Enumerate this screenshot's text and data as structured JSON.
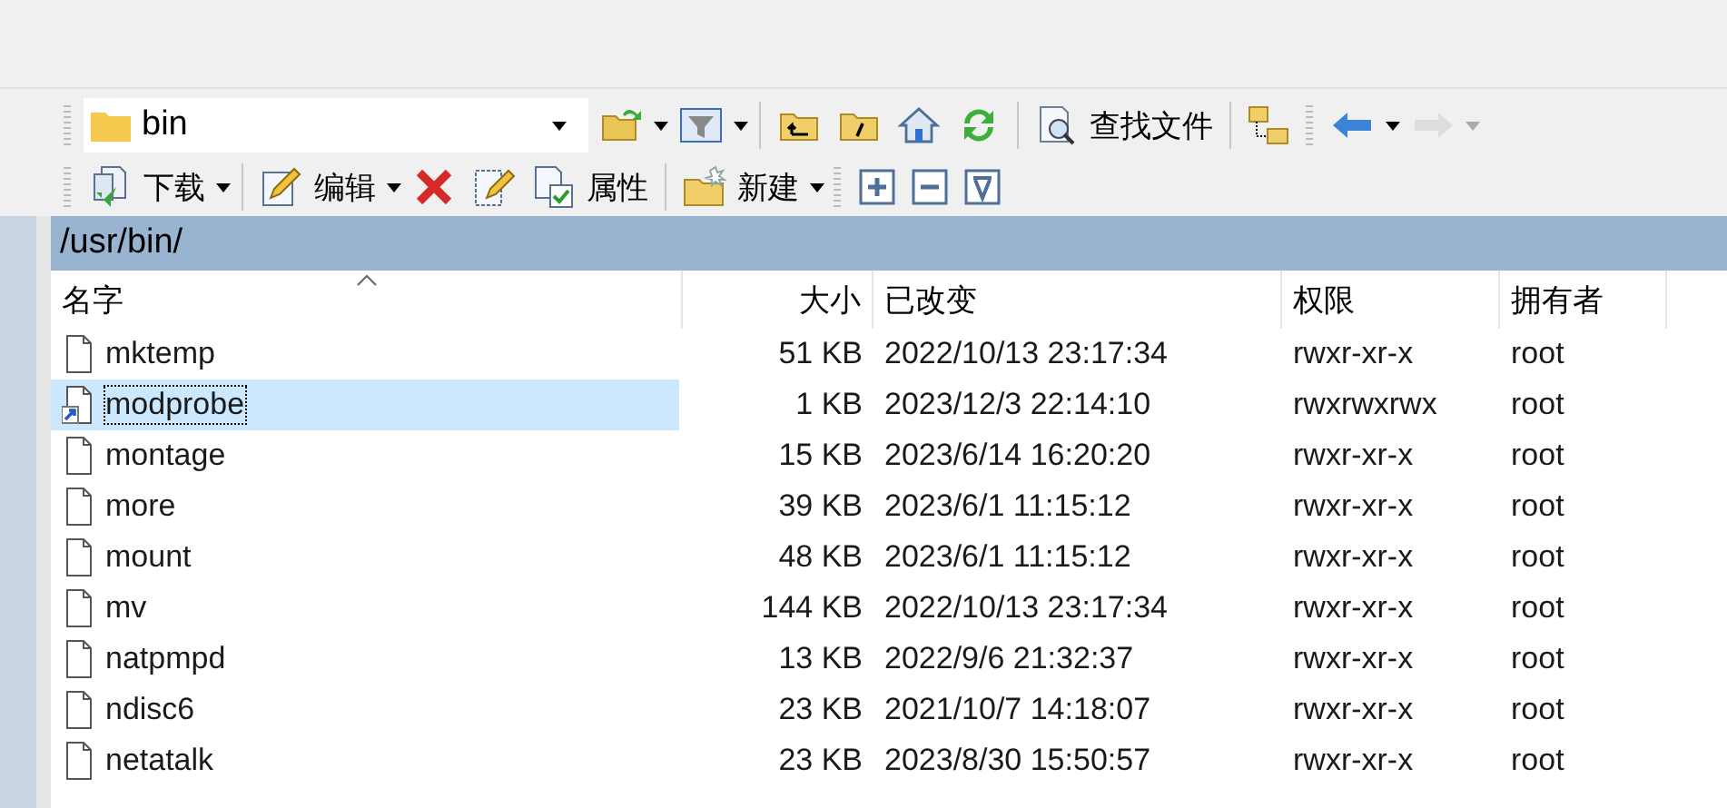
{
  "address": {
    "value": "bin"
  },
  "toolbar_1": [
    {
      "kind": "open-folder",
      "dropdown": true
    },
    {
      "kind": "filter",
      "dropdown": true
    },
    {
      "kind": "sep"
    },
    {
      "kind": "parent-folder"
    },
    {
      "kind": "root-folder"
    },
    {
      "kind": "home"
    },
    {
      "kind": "refresh"
    },
    {
      "kind": "sep"
    },
    {
      "kind": "find",
      "label": "查找文件"
    },
    {
      "kind": "sep"
    },
    {
      "kind": "tree"
    },
    {
      "kind": "grip"
    },
    {
      "kind": "back",
      "dropdown": true,
      "disabled": false
    },
    {
      "kind": "forward",
      "dropdown": true,
      "disabled": true
    }
  ],
  "toolbar_2": [
    {
      "kind": "download",
      "label": "下载",
      "dropdown": true
    },
    {
      "kind": "sep"
    },
    {
      "kind": "edit",
      "label": "编辑",
      "dropdown": true
    },
    {
      "kind": "delete"
    },
    {
      "kind": "rename"
    },
    {
      "kind": "properties",
      "label": "属性"
    },
    {
      "kind": "sep"
    },
    {
      "kind": "new-folder",
      "label": "新建",
      "dropdown": true
    },
    {
      "kind": "grip"
    },
    {
      "kind": "plus"
    },
    {
      "kind": "minus"
    },
    {
      "kind": "filter-mark"
    }
  ],
  "path": "/usr/bin/",
  "columns": [
    {
      "label": "名字",
      "sorted": true
    },
    {
      "label": "大小",
      "sorted": false
    },
    {
      "label": "已改变",
      "sorted": false
    },
    {
      "label": "权限",
      "sorted": false
    },
    {
      "label": "拥有者",
      "sorted": false
    }
  ],
  "rows": [
    {
      "kind": "file",
      "name": "mktemp",
      "size": "51 KB",
      "changed": "2022/10/13 23:17:34",
      "rights": "rwxr-xr-x",
      "owner": "root",
      "selected": false
    },
    {
      "kind": "link",
      "name": "modprobe",
      "size": "1 KB",
      "changed": "2023/12/3 22:14:10",
      "rights": "rwxrwxrwx",
      "owner": "root",
      "selected": true
    },
    {
      "kind": "file",
      "name": "montage",
      "size": "15 KB",
      "changed": "2023/6/14 16:20:20",
      "rights": "rwxr-xr-x",
      "owner": "root",
      "selected": false
    },
    {
      "kind": "file",
      "name": "more",
      "size": "39 KB",
      "changed": "2023/6/1 11:15:12",
      "rights": "rwxr-xr-x",
      "owner": "root",
      "selected": false
    },
    {
      "kind": "file",
      "name": "mount",
      "size": "48 KB",
      "changed": "2023/6/1 11:15:12",
      "rights": "rwxr-xr-x",
      "owner": "root",
      "selected": false
    },
    {
      "kind": "file",
      "name": "mv",
      "size": "144 KB",
      "changed": "2022/10/13 23:17:34",
      "rights": "rwxr-xr-x",
      "owner": "root",
      "selected": false
    },
    {
      "kind": "file",
      "name": "natpmpd",
      "size": "13 KB",
      "changed": "2022/9/6 21:32:37",
      "rights": "rwxr-xr-x",
      "owner": "root",
      "selected": false
    },
    {
      "kind": "file",
      "name": "ndisc6",
      "size": "23 KB",
      "changed": "2021/10/7 14:18:07",
      "rights": "rwxr-xr-x",
      "owner": "root",
      "selected": false
    },
    {
      "kind": "file",
      "name": "netatalk",
      "size": "23 KB",
      "changed": "2023/8/30 15:50:57",
      "rights": "rwxr-xr-x",
      "owner": "root",
      "selected": false
    }
  ]
}
